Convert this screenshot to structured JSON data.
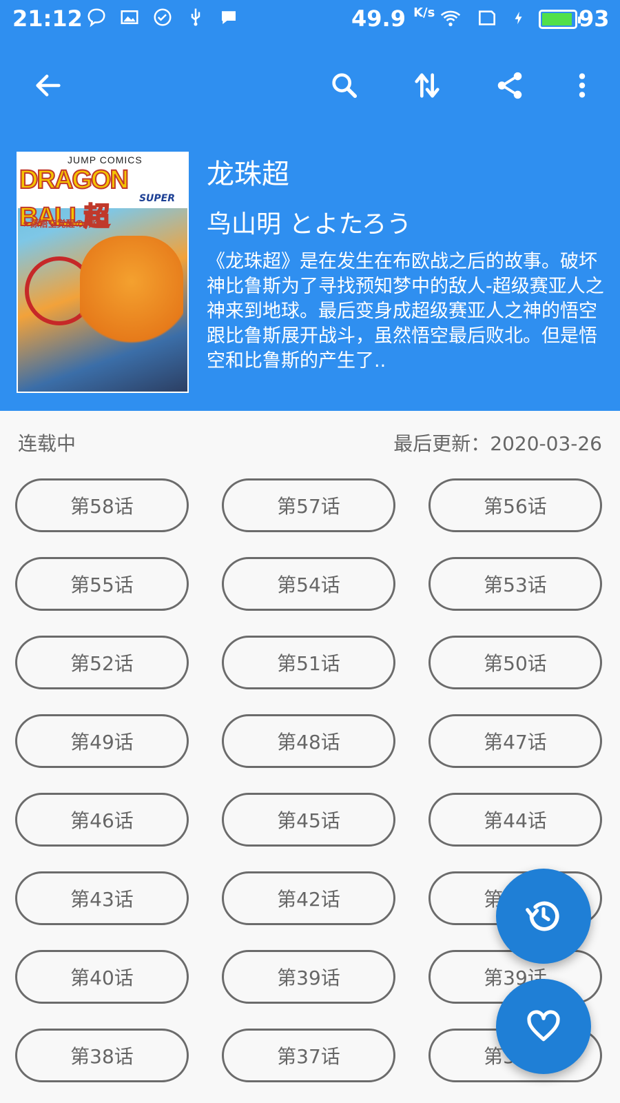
{
  "status_bar": {
    "time": "21:12",
    "network_speed": "49.9",
    "network_unit": "K/s",
    "battery_percent": "93",
    "icons_left": [
      "messenger-icon",
      "image-icon",
      "check-circle-icon",
      "usb-icon",
      "chat-icon"
    ],
    "icons_right": [
      "wifi-icon",
      "sim-card-icon",
      "charging-icon",
      "battery-icon"
    ]
  },
  "toolbar": {
    "back_icon": "arrow-back-icon",
    "search_icon": "search-icon",
    "sort_icon": "sort-icon",
    "share_icon": "share-icon",
    "more_icon": "more-vert-icon"
  },
  "comic": {
    "cover_top_text": "JUMP COMICS",
    "cover_logo_text": "DRAGON BALL超",
    "cover_super_text": "SUPER",
    "cover_subtitle_text": "★孫悟空覚醒の\"兆\"",
    "title": "龙珠超",
    "author": "鸟山明 とよたろう",
    "description": "《龙珠超》是在发生在布欧战之后的故事。破坏神比鲁斯为了寻找预知梦中的敌人-超级赛亚人之神来到地球。最后变身成超级赛亚人之神的悟空跟比鲁斯展开战斗，虽然悟空最后败北。但是悟空和比鲁斯的产生了..",
    "status": "连载中",
    "last_updated": "最后更新：2020-03-26"
  },
  "chapters": [
    "第58话",
    "第57话",
    "第56话",
    "第55话",
    "第54话",
    "第53话",
    "第52话",
    "第51话",
    "第50话",
    "第49话",
    "第48话",
    "第47话",
    "第46话",
    "第45话",
    "第44话",
    "第43话",
    "第42话",
    "第41话",
    "第40话",
    "第39话",
    "第39话",
    "第38话",
    "第37话",
    "第36话"
  ],
  "fabs": {
    "history_icon": "history-icon",
    "favorite_icon": "heart-icon"
  },
  "colors": {
    "primary": "#2f8ff0",
    "fab": "#1f7fd6",
    "chip_border": "#6b6b6b",
    "chip_text": "#666666"
  }
}
